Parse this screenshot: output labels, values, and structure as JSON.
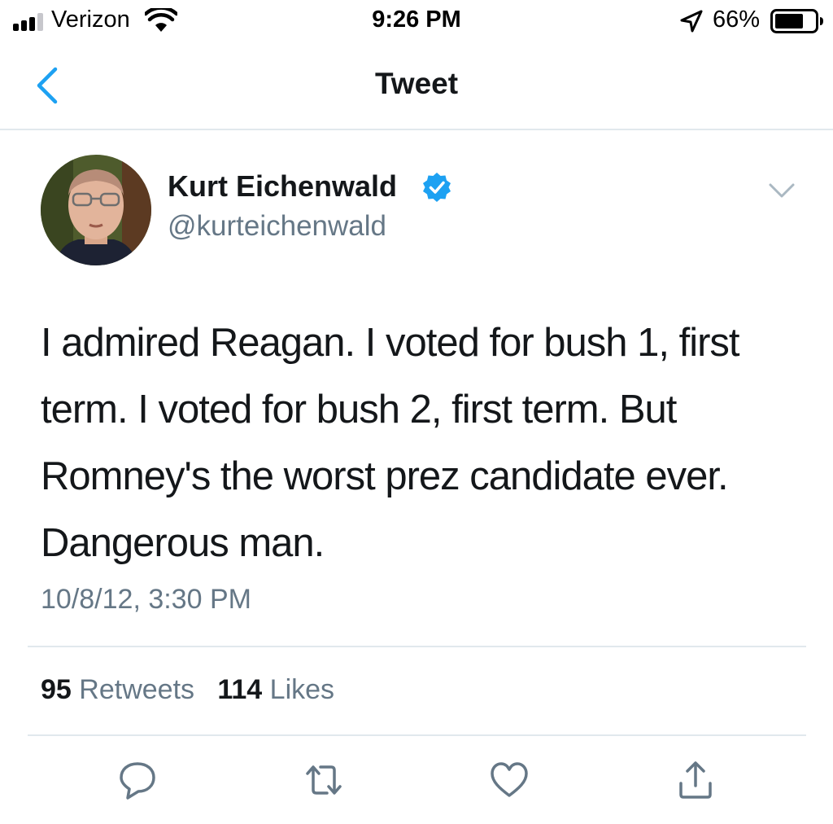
{
  "status_bar": {
    "carrier": "Verizon",
    "time": "9:26 PM",
    "battery_percent": "66%"
  },
  "nav": {
    "title": "Tweet"
  },
  "tweet": {
    "author_name": "Kurt Eichenwald",
    "author_handle": "@kurteichenwald",
    "verified": true,
    "text": "I admired Reagan. I voted for bush 1, first term. I voted for bush 2, first term. But Romney's the worst prez candidate ever. Dangerous man.",
    "timestamp": "10/8/12, 3:30 PM"
  },
  "stats": {
    "retweets_count": "95",
    "retweets_label": "Retweets",
    "likes_count": "114",
    "likes_label": "Likes"
  },
  "colors": {
    "accent": "#1da1f2",
    "text": "#14171a",
    "secondary": "#657786",
    "divider": "#e1e8ed"
  },
  "icons": {
    "actions": [
      "reply-icon",
      "retweet-icon",
      "like-icon",
      "share-icon"
    ]
  }
}
